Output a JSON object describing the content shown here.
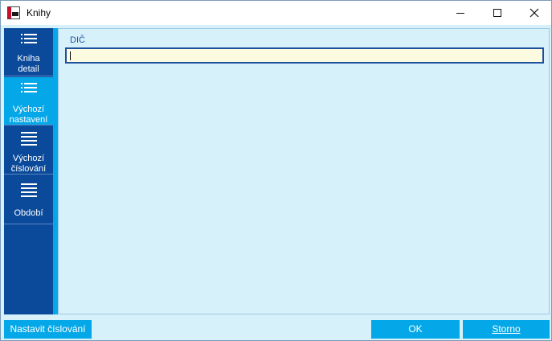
{
  "window": {
    "title": "Knihy",
    "controls": [
      "minimize",
      "maximize",
      "close"
    ]
  },
  "sidebar": {
    "items": [
      {
        "line1": "Kniha",
        "line2": "detail",
        "icon": "list-icon",
        "active": false
      },
      {
        "line1": "Výchozí",
        "line2": "nastavení",
        "icon": "list-icon",
        "active": true
      },
      {
        "line1": "Výchozí",
        "line2": "číslování",
        "icon": "menu-icon",
        "active": false
      },
      {
        "line1": "Období",
        "line2": "",
        "icon": "menu-icon",
        "active": false
      }
    ]
  },
  "form": {
    "dic_label": "DIČ",
    "dic_value": ""
  },
  "footer": {
    "nastavit_label": "Nastavit číslování",
    "ok_label": "OK",
    "storno_label": "Storno"
  },
  "colors": {
    "sidebar_bg": "#0b4a9b",
    "accent": "#04a8e8",
    "panel_bg": "#d7f1fb",
    "input_bg": "#fcfbe0",
    "input_border": "#1e50a0"
  }
}
